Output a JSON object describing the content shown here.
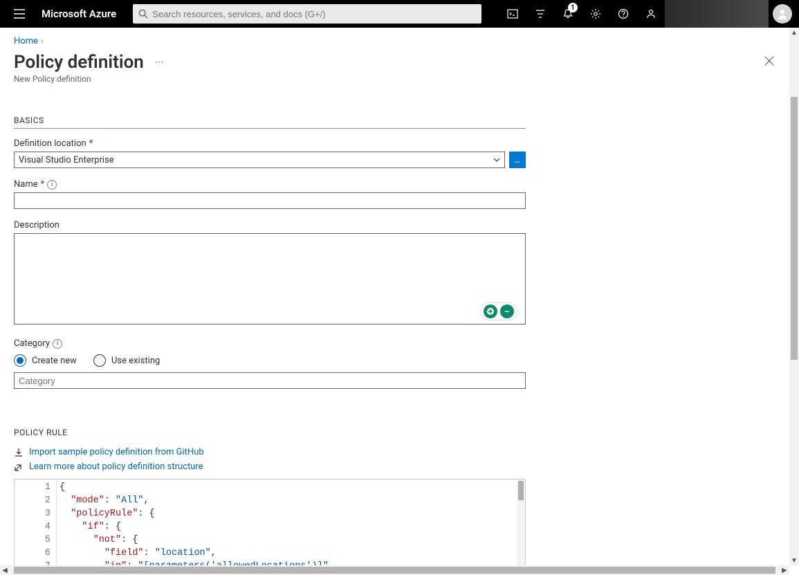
{
  "header": {
    "brand": "Microsoft Azure",
    "search_placeholder": "Search resources, services, and docs (G+/)",
    "notification_badge": "1"
  },
  "breadcrumb": {
    "home": "Home"
  },
  "page": {
    "title": "Policy definition",
    "subtitle": "New Policy definition"
  },
  "basics": {
    "section_label": "BASICS",
    "definition_location_label": "Definition location",
    "definition_location_value": "Visual Studio Enterprise",
    "name_label": "Name",
    "name_value": "",
    "description_label": "Description",
    "description_value": "",
    "category_label": "Category",
    "category_radio_create": "Create new",
    "category_radio_use": "Use existing",
    "category_selected": "create",
    "category_placeholder": "Category",
    "category_value": ""
  },
  "policy_rule": {
    "section_label": "POLICY RULE",
    "import_link": "Import sample policy definition from GitHub",
    "learn_link": "Learn more about policy definition structure",
    "lines": [
      {
        "num": 1,
        "tokens": [
          {
            "t": "{",
            "c": "brace"
          }
        ]
      },
      {
        "num": 2,
        "tokens": [
          {
            "t": "  ",
            "c": "punc"
          },
          {
            "t": "\"mode\"",
            "c": "key"
          },
          {
            "t": ": ",
            "c": "punc"
          },
          {
            "t": "\"All\"",
            "c": "str"
          },
          {
            "t": ",",
            "c": "punc"
          }
        ]
      },
      {
        "num": 3,
        "tokens": [
          {
            "t": "  ",
            "c": "punc"
          },
          {
            "t": "\"policyRule\"",
            "c": "key"
          },
          {
            "t": ": {",
            "c": "punc"
          }
        ]
      },
      {
        "num": 4,
        "tokens": [
          {
            "t": "    ",
            "c": "punc"
          },
          {
            "t": "\"if\"",
            "c": "key"
          },
          {
            "t": ": {",
            "c": "punc"
          }
        ]
      },
      {
        "num": 5,
        "tokens": [
          {
            "t": "      ",
            "c": "punc"
          },
          {
            "t": "\"not\"",
            "c": "key"
          },
          {
            "t": ": {",
            "c": "punc"
          }
        ]
      },
      {
        "num": 6,
        "tokens": [
          {
            "t": "        ",
            "c": "punc"
          },
          {
            "t": "\"field\"",
            "c": "key"
          },
          {
            "t": ": ",
            "c": "punc"
          },
          {
            "t": "\"location\"",
            "c": "str"
          },
          {
            "t": ",",
            "c": "punc"
          }
        ]
      },
      {
        "num": 7,
        "tokens": [
          {
            "t": "        ",
            "c": "punc"
          },
          {
            "t": "\"in\"",
            "c": "key"
          },
          {
            "t": ": ",
            "c": "punc"
          },
          {
            "t": "\"[parameters('allowedLocations')]\"",
            "c": "param"
          }
        ]
      }
    ]
  }
}
